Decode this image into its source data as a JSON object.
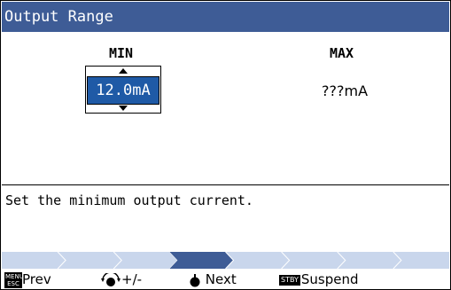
{
  "title": "Output Range",
  "columns": {
    "min_label": "MIN",
    "max_label": "MAX"
  },
  "min_value": "12.0mA",
  "max_value": "???mA",
  "message": "Set the minimum output current.",
  "progress": {
    "steps": 8,
    "current_step": 3
  },
  "footer": {
    "menu_key": "MENU\nESC",
    "prev_label": "Prev",
    "adjust_label": "+/-",
    "next_label": "Next",
    "stby_key": "STBY",
    "suspend_label": "Suspend"
  },
  "colors": {
    "title_bg": "#3e5c96",
    "selected_bg": "#1f5aa6",
    "progress_bg": "#c9d6ec",
    "progress_active": "#3e5c96"
  }
}
